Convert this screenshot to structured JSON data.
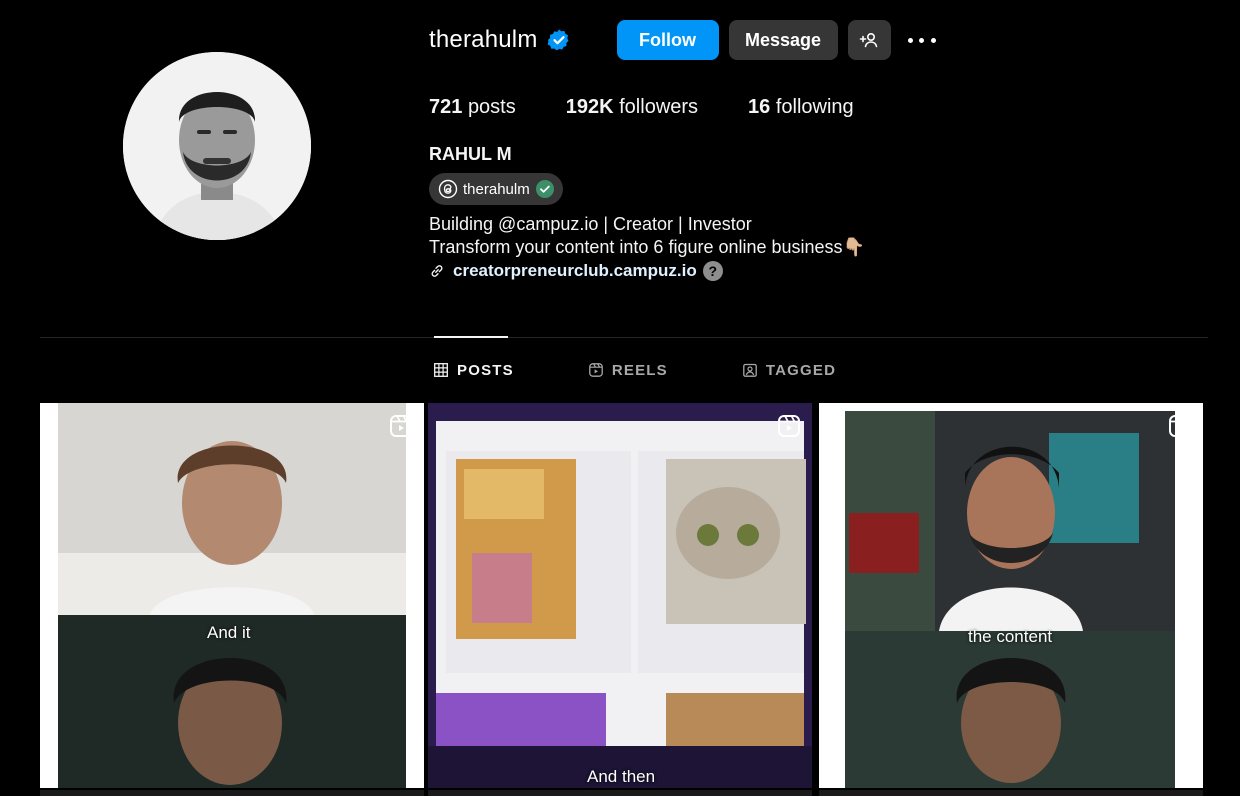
{
  "profile": {
    "username": "therahulm",
    "verified": true,
    "follow_label": "Follow",
    "message_label": "Message",
    "name": "RAHUL M",
    "threads_handle": "therahulm",
    "bio_line1": "Building @campuz.io | Creator | Investor",
    "bio_line2": "Transform your content into 6 figure online business👇🏼",
    "link": "creatorpreneurclub.campuz.io",
    "link_badge": "?"
  },
  "stats": {
    "posts_count": "721",
    "posts_label": "posts",
    "followers_count": "192K",
    "followers_label": "followers",
    "following_count": "16",
    "following_label": "following"
  },
  "tabs": [
    {
      "label": "POSTS",
      "icon": "grid-icon",
      "active": true
    },
    {
      "label": "REELS",
      "icon": "reels-icon",
      "active": false
    },
    {
      "label": "TAGGED",
      "icon": "tagged-icon",
      "active": false
    }
  ],
  "posts": [
    {
      "caption": "And it",
      "type": "reel"
    },
    {
      "caption": "And then",
      "type": "reel"
    },
    {
      "caption": "the content",
      "type": "reel"
    }
  ],
  "colors": {
    "accent": "#0095f6",
    "background": "#000000",
    "button_secondary": "#363636",
    "verified_badge": "#0095f6"
  }
}
